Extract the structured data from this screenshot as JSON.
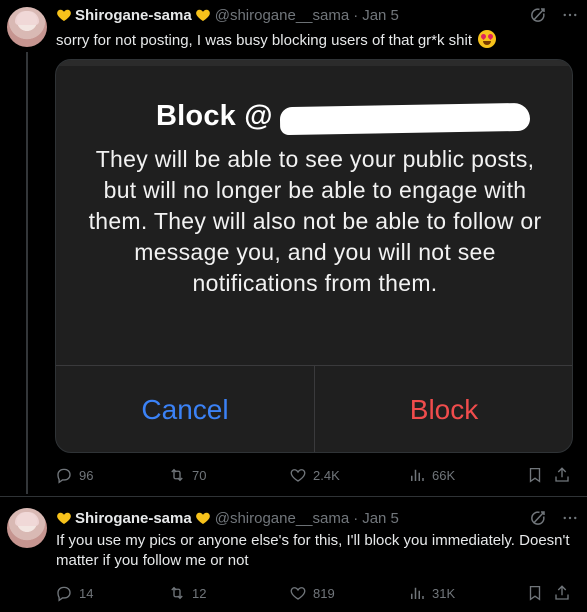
{
  "tweets": [
    {
      "display_name": "Shirogane-sama",
      "handle": "@shirogane__sama",
      "separator": "·",
      "date": "Jan 5",
      "text": "sorry for not posting, I was busy blocking users of that gr*k shit",
      "emoji": "heart-eyes-emoji",
      "media": {
        "title": "Block @",
        "body": "They will be able to see your public posts, but will no longer be able to engage with them. They will also not be able to follow or message you, and you will not see notifications from them.",
        "cancel_label": "Cancel",
        "block_label": "Block"
      },
      "stats": {
        "replies": "96",
        "retweets": "70",
        "likes": "2.4K",
        "views": "66K"
      }
    },
    {
      "display_name": "Shirogane-sama",
      "handle": "@shirogane__sama",
      "separator": "·",
      "date": "Jan 5",
      "text": "If you use my pics or anyone else's for this, I'll block you immediately. Doesn't matter if you follow me or not",
      "stats": {
        "replies": "14",
        "retweets": "12",
        "likes": "819",
        "views": "31K"
      }
    }
  ],
  "colors": {
    "background": "#000000",
    "muted": "#71767b",
    "heart": "#f7c21b",
    "cancel": "#3b82f6",
    "block": "#f04c4c"
  },
  "icons": [
    "yellow-heart-icon",
    "grok-icon",
    "more-icon",
    "reply-icon",
    "retweet-icon",
    "like-icon",
    "views-icon",
    "bookmark-icon",
    "share-icon"
  ]
}
